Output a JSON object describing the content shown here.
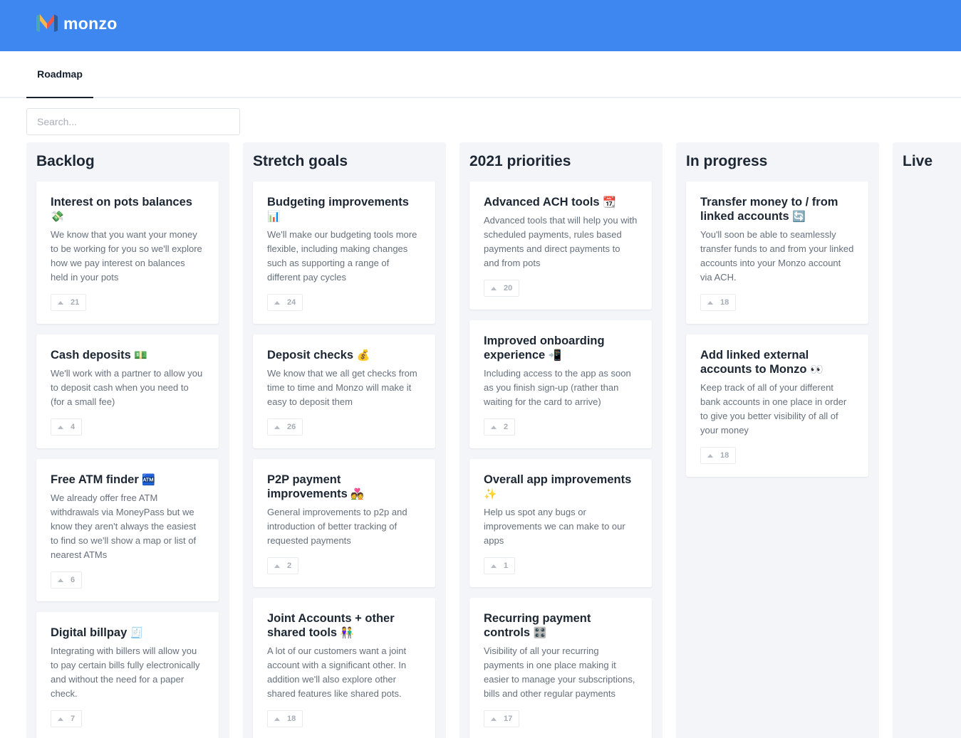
{
  "header": {
    "brand": "monzo"
  },
  "tabs": [
    {
      "label": "Roadmap"
    }
  ],
  "search": {
    "placeholder": "Search...",
    "value": ""
  },
  "columns": [
    {
      "title": "Backlog",
      "cards": [
        {
          "title": "Interest on pots balances",
          "emoji": "💸",
          "desc": "We know that you want your money to be working for you so we'll explore how we pay interest on balances held in your pots",
          "votes": "21"
        },
        {
          "title": "Cash deposits",
          "emoji": "💵",
          "desc": "We'll work with a partner to allow you to deposit cash when you need to (for a small fee)",
          "votes": "4"
        },
        {
          "title": "Free ATM finder",
          "emoji": "🏧",
          "desc": "We already offer free ATM withdrawals via MoneyPass but we know they aren't always the easiest to find so we'll show a map or list of nearest ATMs",
          "votes": "6"
        },
        {
          "title": "Digital billpay",
          "emoji": "🧾",
          "desc": "Integrating with billers will allow you to pay certain bills fully electronically and without the need for a paper check.",
          "votes": "7"
        }
      ]
    },
    {
      "title": "Stretch goals",
      "cards": [
        {
          "title": "Budgeting improvements",
          "emoji": "📊",
          "desc": "We'll make our budgeting tools more flexible, including making changes such as supporting a range of different pay cycles",
          "votes": "24"
        },
        {
          "title": "Deposit checks",
          "emoji": "💰",
          "desc": "We know that we all get checks from time to time and Monzo will make it easy to deposit them",
          "votes": "26"
        },
        {
          "title": "P2P payment improvements",
          "emoji": "💑",
          "desc": "General improvements to p2p and introduction of better tracking of requested payments",
          "votes": "2"
        },
        {
          "title": "Joint Accounts + other shared tools",
          "emoji": "👫",
          "desc": "A lot of our customers want a joint account with a significant other. In addition we'll also explore other shared features like shared pots.",
          "votes": "18"
        }
      ]
    },
    {
      "title": "2021 priorities",
      "cards": [
        {
          "title": "Advanced ACH tools",
          "emoji": "📆",
          "desc": "Advanced tools that will help you with scheduled payments, rules based payments and direct payments to and from pots",
          "votes": "20"
        },
        {
          "title": "Improved onboarding experience",
          "emoji": "📲",
          "desc": "Including access to the app as soon as you finish sign-up (rather than waiting for the card to arrive)",
          "votes": "2"
        },
        {
          "title": "Overall app improvements",
          "emoji": "✨",
          "desc": "Help us spot any bugs or improvements we can make to our apps",
          "votes": "1"
        },
        {
          "title": "Recurring payment controls",
          "emoji": "🎛️",
          "desc": "Visibility of all your recurring payments in one place making it easier to manage your subscriptions, bills and other regular payments",
          "votes": "17"
        }
      ]
    },
    {
      "title": "In progress",
      "cards": [
        {
          "title": "Transfer money to / from linked accounts",
          "emoji": "🔄",
          "desc": "You'll soon be able to seamlessly transfer funds to and from your linked accounts into your Monzo account via ACH.",
          "votes": "18"
        },
        {
          "title": "Add linked external accounts to Monzo",
          "emoji": "👀",
          "desc": "Keep track of all of your different bank accounts in one place in order to give you better visibility of all of your money",
          "votes": "18"
        }
      ]
    },
    {
      "title": "Live",
      "cards": []
    }
  ]
}
